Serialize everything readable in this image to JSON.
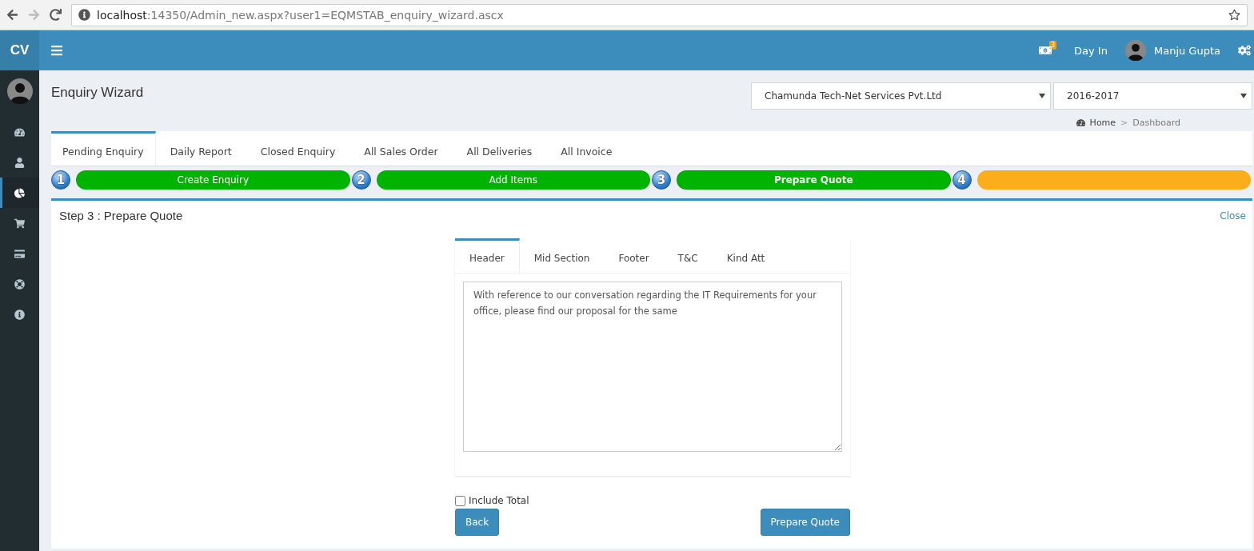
{
  "browser": {
    "url_host": "localhost",
    "url_rest": ":14350/Admin_new.aspx?user1=EQMSTAB_enquiry_wizard.ascx"
  },
  "navbar": {
    "logo": "CV",
    "notification_count": "3",
    "day_in": "Day In",
    "user_name": "Manju Gupta"
  },
  "sidebar": {
    "items": [
      {
        "kind": "dashboard",
        "selected": false
      },
      {
        "kind": "user",
        "selected": false
      },
      {
        "kind": "chart",
        "selected": true
      },
      {
        "kind": "cart",
        "selected": false
      },
      {
        "kind": "card",
        "selected": false
      },
      {
        "kind": "lifering",
        "selected": false
      },
      {
        "kind": "info",
        "selected": false
      }
    ]
  },
  "page_title": "Enquiry Wizard",
  "company_select": {
    "value": "Chamunda Tech-Net Services Pvt.Ltd"
  },
  "year_select": {
    "value": "2016-2017"
  },
  "breadcrumb": {
    "home": "Home",
    "separator": ">",
    "current": "Dashboard"
  },
  "tabs": [
    {
      "label": "Pending Enquiry",
      "selected": true
    },
    {
      "label": "Daily Report",
      "selected": false
    },
    {
      "label": "Closed Enquiry",
      "selected": false
    },
    {
      "label": "All Sales Order",
      "selected": false
    },
    {
      "label": "All Deliveries",
      "selected": false
    },
    {
      "label": "All Invoice",
      "selected": false
    }
  ],
  "wizard_steps": [
    {
      "number": "1",
      "label": "Create Enquiry",
      "completed": true,
      "current": false
    },
    {
      "number": "2",
      "label": "Add Items",
      "completed": true,
      "current": false
    },
    {
      "number": "3",
      "label": "Prepare Quote",
      "completed": true,
      "current": true
    },
    {
      "number": "4",
      "completed": false,
      "current": false
    }
  ],
  "panel": {
    "title": "Step 3 : Prepare Quote",
    "close": "Close"
  },
  "section_tabs": [
    {
      "label": "Header",
      "selected": true
    },
    {
      "label": "Mid Section",
      "selected": false
    },
    {
      "label": "Footer",
      "selected": false
    },
    {
      "label": "T&C",
      "selected": false
    },
    {
      "label": "Kind Att",
      "selected": false
    }
  ],
  "header_text": "With reference to our conversation regarding the IT Requirements for your office, please find our proposal for the same",
  "include_total": {
    "label": "Include Total",
    "checked": false
  },
  "buttons": {
    "back": "Back",
    "prepare": "Prepare Quote"
  }
}
